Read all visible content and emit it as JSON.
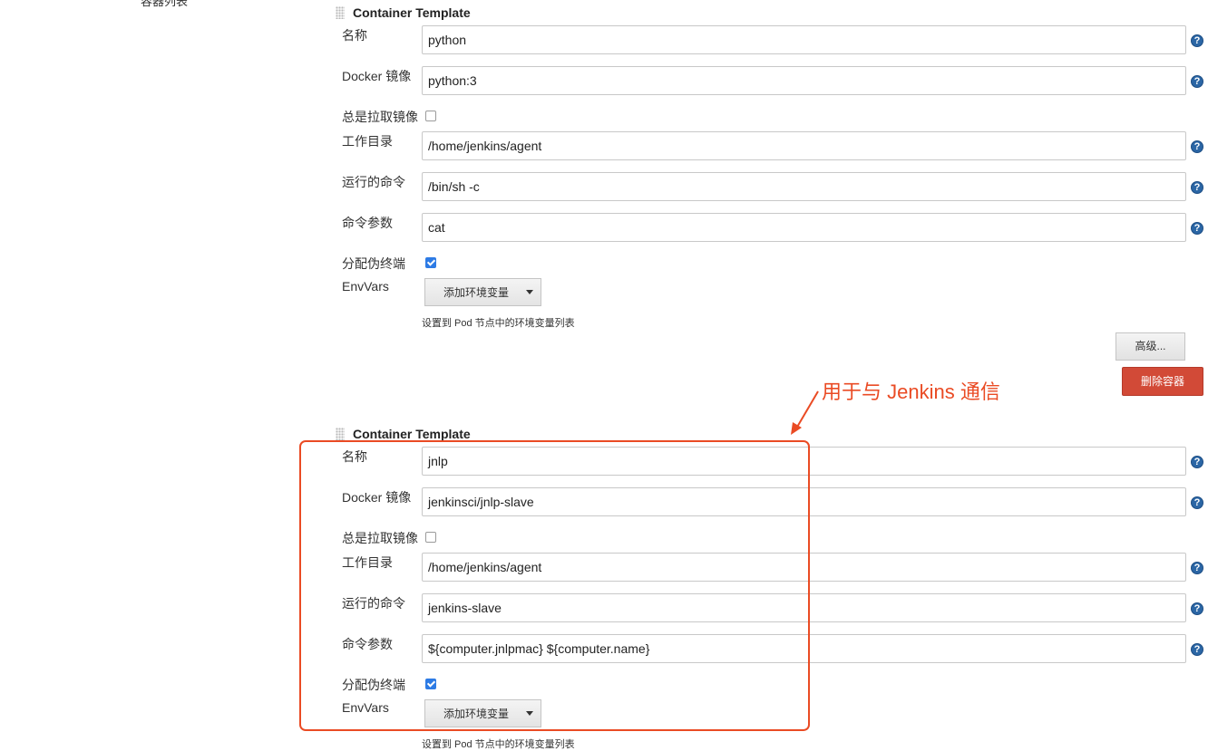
{
  "partial_label": "容器列表",
  "labels": {
    "name": "名称",
    "image": "Docker 镜像",
    "always_pull": "总是拉取镜像",
    "working_dir": "工作目录",
    "command": "运行的命令",
    "args": "命令参数",
    "tty": "分配伪终端",
    "envvars": "EnvVars"
  },
  "containers": [
    {
      "title": "Container Template",
      "name": "python",
      "image": "python:3",
      "always_pull": false,
      "working_dir": "/home/jenkins/agent",
      "command": "/bin/sh -c",
      "args": "cat",
      "tty": true,
      "add_env_label": "添加环境变量",
      "env_hint": "设置到 Pod 节点中的环境变量列表"
    },
    {
      "title": "Container Template",
      "name": "jnlp",
      "image": "jenkinsci/jnlp-slave",
      "always_pull": false,
      "working_dir": "/home/jenkins/agent",
      "command": "jenkins-slave",
      "args": "${computer.jnlpmac} ${computer.name}",
      "tty": true,
      "add_env_label": "添加环境变量",
      "env_hint": "设置到 Pod 节点中的环境变量列表"
    }
  ],
  "buttons": {
    "advanced": "高级...",
    "delete_container": "删除容器"
  },
  "annotation": {
    "text": "用于与 Jenkins 通信",
    "color": "#ea4b24"
  },
  "colors": {
    "help_icon": "#2b66a5",
    "delete_button": "#d24a37",
    "checkbox_checked": "#2d7be5"
  },
  "icons": {
    "help": "help-icon",
    "drag": "drag-handle-icon",
    "dropdown": "caret-down-icon"
  }
}
